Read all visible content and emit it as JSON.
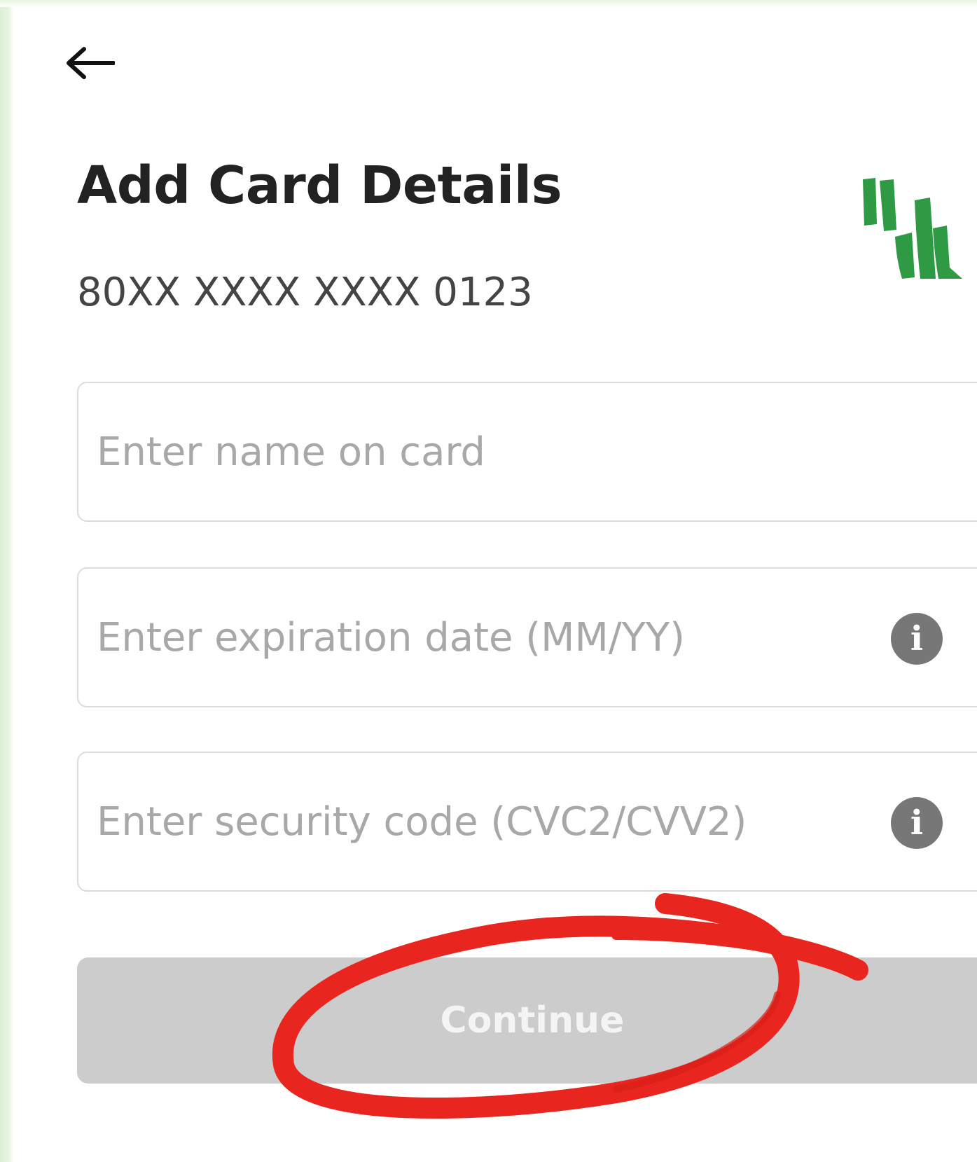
{
  "header": {
    "back_icon": "arrow-left-icon",
    "title": "Add Card Details",
    "card_number": "80XX XXXX XXXX 0123",
    "logo_icon": "bank-logo",
    "logo_color": "#2e9a44"
  },
  "form": {
    "name_field": {
      "placeholder": "Enter name on card",
      "value": ""
    },
    "expiry_field": {
      "placeholder": "Enter expiration date (MM/YY)",
      "value": "",
      "info_icon": "info-icon"
    },
    "security_field": {
      "placeholder": "Enter security code (CVC2/CVV2)",
      "value": "",
      "info_icon": "info-icon"
    }
  },
  "continue_button": {
    "label": "Continue",
    "state": "disabled"
  },
  "annotation": {
    "type": "hand-drawn red circle around Continue button",
    "color": "#e8261f"
  }
}
